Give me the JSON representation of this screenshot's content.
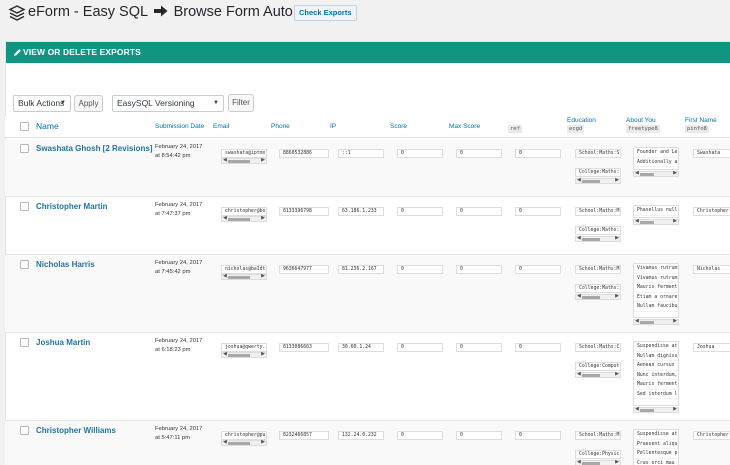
{
  "header": {
    "app": "eForm - Easy SQL",
    "page": "Browse Form Auto Exports",
    "check_button": "Check Exports"
  },
  "panel": {
    "title": "VIEW OR DELETE EXPORTS"
  },
  "toolbar": {
    "bulk_select": "Bulk Actions",
    "apply": "Apply",
    "filter_select": "EasySQL Versioning",
    "filter": "Filter"
  },
  "columns": {
    "name": "Name",
    "date": "Submission Date",
    "email": "Email",
    "phone": "Phone",
    "ip": "IP",
    "score": "Score",
    "max_score": "Max Score",
    "ref_tag": "ref",
    "education": "Education",
    "education_tag": "ecgd",
    "about": "About You",
    "about_tag": "freetype8",
    "first_name": "First Name",
    "first_tag": "pinfo8"
  },
  "rows": [
    {
      "name": "Swashata Ghosh [2 Revisions]",
      "date1": "February 24, 2017",
      "date2": "at 8:54:42 pm",
      "email": "swashata@iptms",
      "phone": "8860532886",
      "ip": "::1",
      "score": "0",
      "max": "0",
      "ref": "0",
      "edu1": "School:Maths:S",
      "edu2": "College:Maths:",
      "about": [
        "Founder and Le",
        "Additionally a"
      ],
      "first": "Swashata"
    },
    {
      "name": "Christopher Martin",
      "date1": "February 24, 2017",
      "date2": "at 7:47:37 pm",
      "email": "christopher@bo",
      "phone": "8133396798",
      "ip": "63.186.1.233",
      "score": "0",
      "max": "0",
      "ref": "0",
      "edu1": "School:Maths:M",
      "edu2": "College:Maths:",
      "about": [
        "Phasellus null"
      ],
      "first": "Christopher"
    },
    {
      "name": "Nicholas Harris",
      "date1": "February 24, 2017",
      "date2": "at 7:45:42 pm",
      "email": "nicholas@ba1dt",
      "phone": "9636647977",
      "ip": "81.236.2.167",
      "score": "0",
      "max": "0",
      "ref": "0",
      "edu1": "School:Maths:M",
      "edu2": "College:Maths:",
      "about": [
        "Vivamus rutrum",
        "Vivamus rutrum",
        "Mauris ferment",
        "Etiam a ornare",
        "Nullam faucibu"
      ],
      "first": "Nicholas"
    },
    {
      "name": "Joshua Martin",
      "date1": "February 24, 2017",
      "date2": "at 6:18:23 pm",
      "email": "joshua@qwerty.",
      "phone": "8133086663",
      "ip": "30.60.1.24",
      "score": "0",
      "max": "0",
      "ref": "0",
      "edu1": "School:Maths:C",
      "edu2": "College:Comput",
      "about": [
        "Suspendisse at",
        "Nullam digniss",
        "Aenean cursus",
        "Nunc interdum,",
        "Mauris ferment",
        "Sed interdum l"
      ],
      "first": "Joshua"
    },
    {
      "name": "Christopher Williams",
      "date1": "February 24, 2017",
      "date2": "at 5:47:11 pm",
      "email": "christopher@pu",
      "phone": "8232466857",
      "ip": "132.24.0.232",
      "score": "0",
      "max": "0",
      "ref": "0",
      "edu1": "School:Maths:M",
      "edu2": "College:Physic",
      "about": [
        "Suspendisse at",
        "Praesent aliqu",
        "Pellentesque p",
        "Cras orci mau"
      ],
      "first": "Christopher"
    }
  ]
}
